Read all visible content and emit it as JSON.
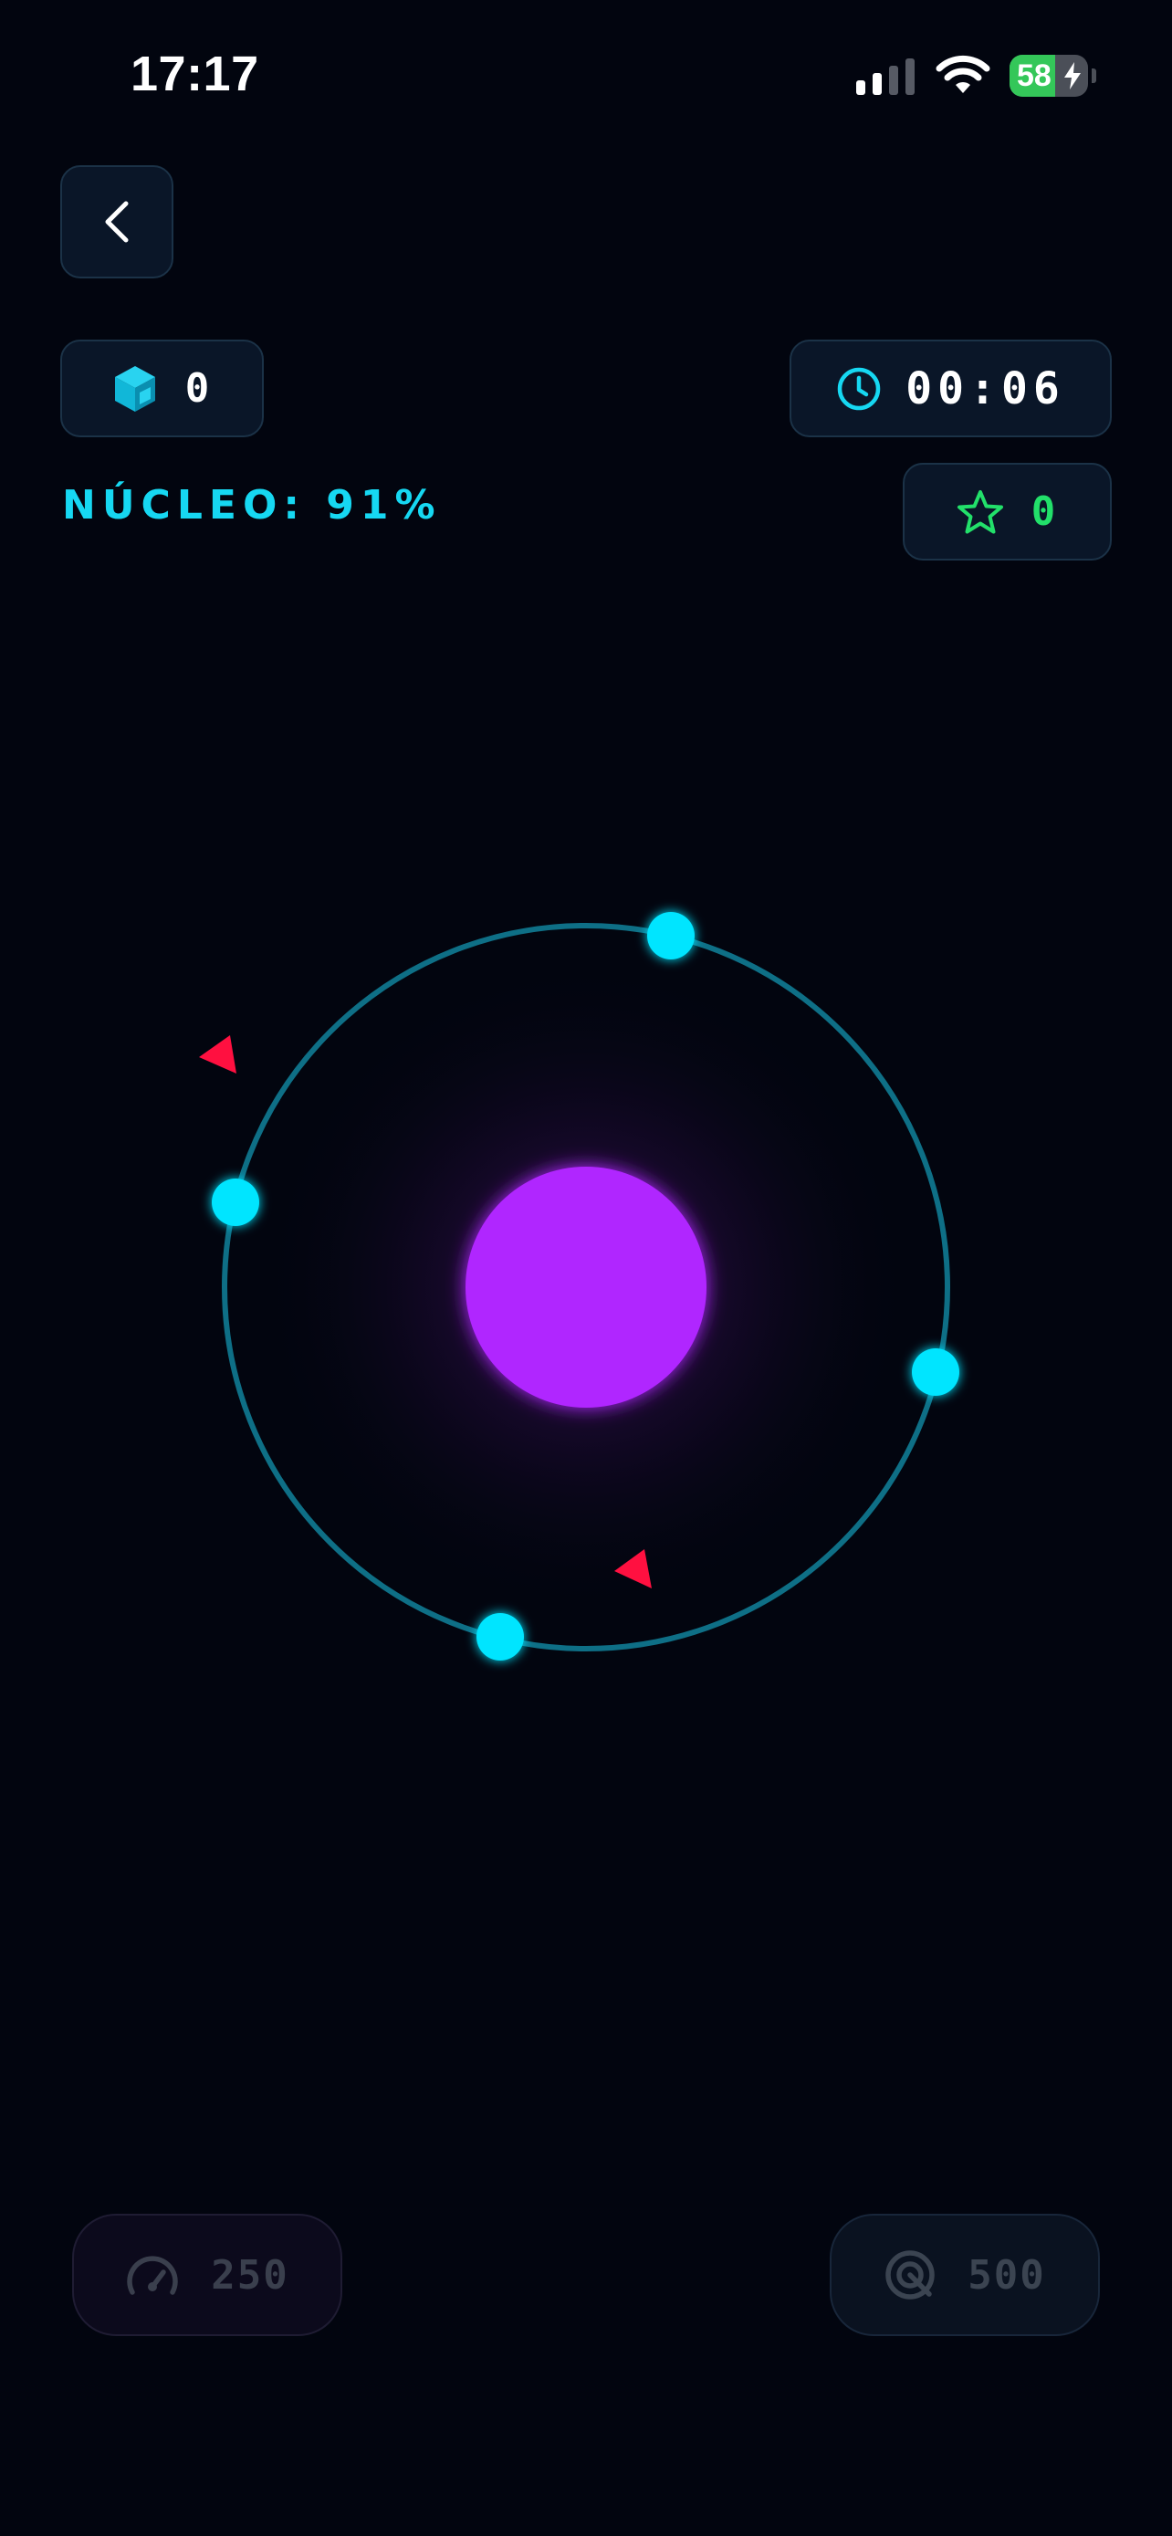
{
  "status_bar": {
    "time": "17:17",
    "battery_percent": "58",
    "signal_bars_active": 2,
    "signal_bars_total": 4
  },
  "hud": {
    "back_icon": "chevron-left-icon",
    "cubes": {
      "icon": "cube-icon",
      "value": "0"
    },
    "timer": {
      "icon": "clock-icon",
      "value": "00:06"
    },
    "stars": {
      "icon": "star-icon",
      "value": "0"
    },
    "core_label": "NÚCLEO: 91%",
    "core_percent": 91
  },
  "game": {
    "core_color": "#b026ff",
    "orbit_color": "#0e6f86",
    "node_color": "#00e5ff",
    "enemy_color": "#ff1040",
    "orbit_nodes": 4,
    "enemies": 2
  },
  "abilities": {
    "speed": {
      "icon": "speedometer-icon",
      "cost": "250"
    },
    "target": {
      "icon": "target-icon",
      "cost": "500"
    }
  }
}
